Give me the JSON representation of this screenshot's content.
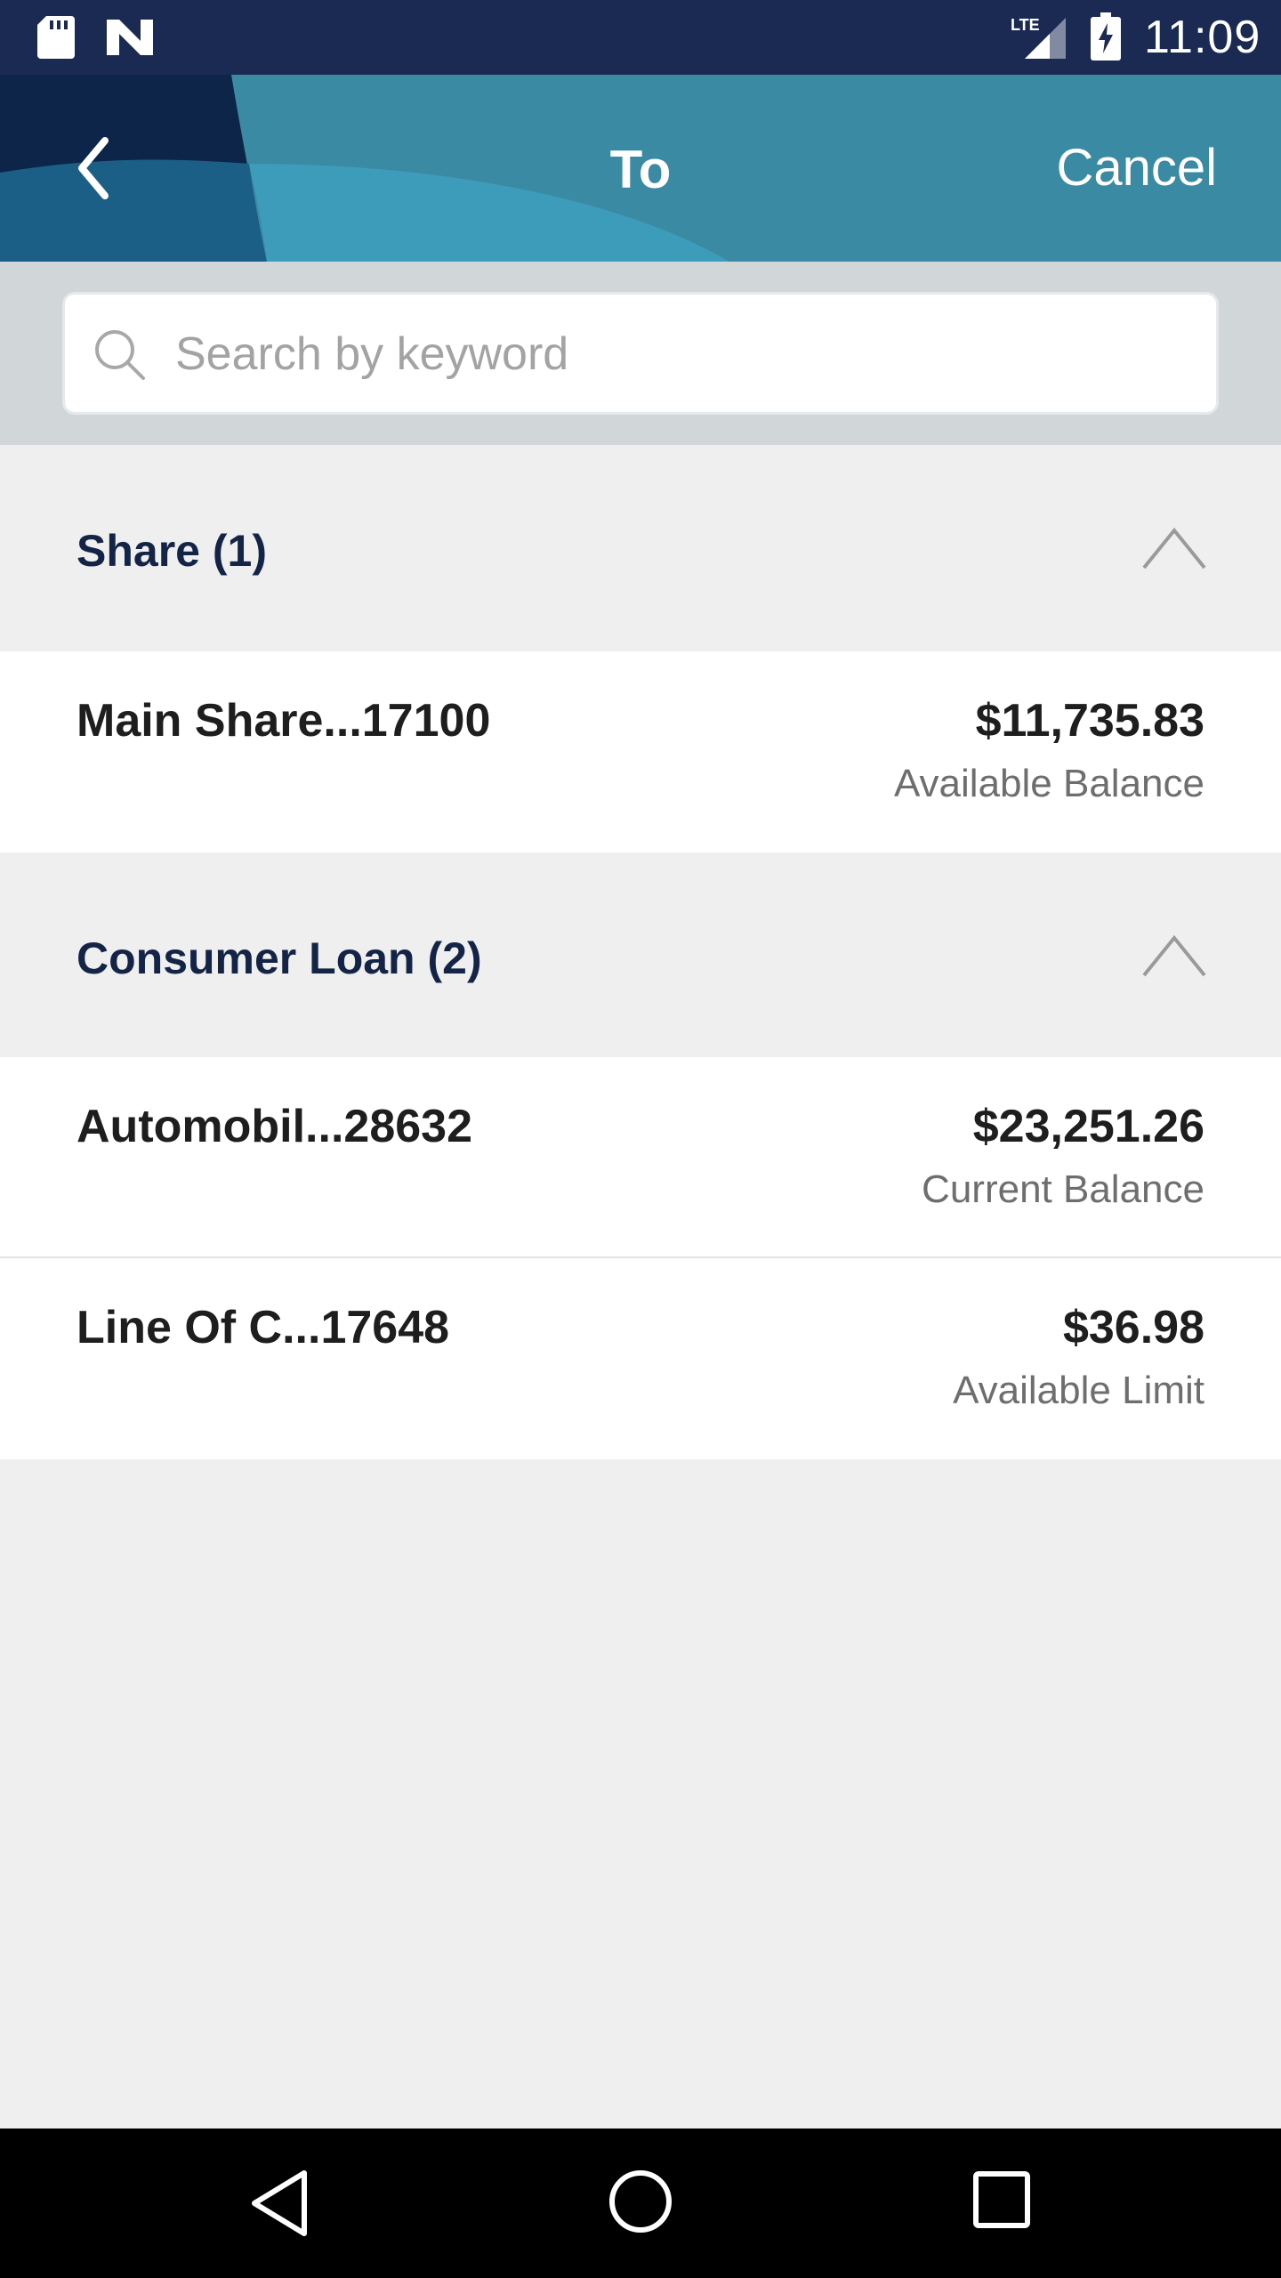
{
  "status_bar": {
    "time": "11:09",
    "icons": [
      "sd-card-icon",
      "n-notification-icon",
      "lte-signal-icon",
      "battery-charging-icon"
    ]
  },
  "header": {
    "title": "To",
    "cancel_label": "Cancel",
    "back_icon": "chevron-left-icon",
    "colors": {
      "dark": "#0e2a4f",
      "mid": "#1f6f92",
      "light": "#3a9ab8",
      "accent": "#3b8aa3"
    }
  },
  "search": {
    "placeholder": "Search by keyword",
    "value": "",
    "icon": "search-icon"
  },
  "sections": [
    {
      "title": "Share (1)",
      "expanded": true,
      "accounts": [
        {
          "name": "Main Share...17100",
          "amount": "$11,735.83",
          "balance_label": "Available Balance"
        }
      ]
    },
    {
      "title": "Consumer Loan (2)",
      "expanded": true,
      "accounts": [
        {
          "name": "Automobil...28632",
          "amount": "$23,251.26",
          "balance_label": "Current Balance"
        },
        {
          "name": "Line Of C...17648",
          "amount": "$36.98",
          "balance_label": "Available Limit"
        }
      ]
    }
  ],
  "nav_bar": {
    "icons": [
      "nav-back-icon",
      "nav-home-icon",
      "nav-recents-icon"
    ]
  }
}
